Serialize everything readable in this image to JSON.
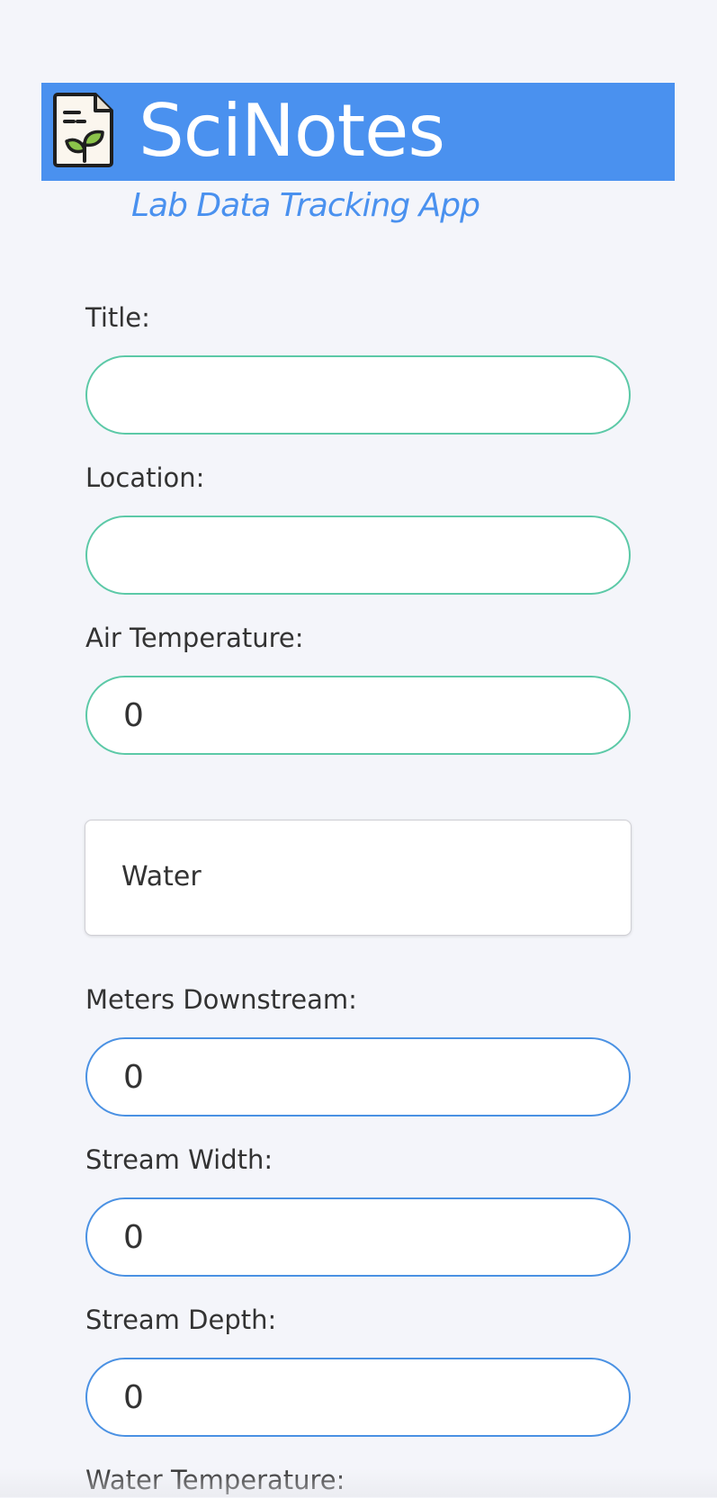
{
  "header": {
    "app_title": "SciNotes",
    "app_subtitle": "Lab Data Tracking App",
    "logo_icon": "document-sprout-icon",
    "banner_color": "#4a91ef"
  },
  "form": {
    "title": {
      "label": "Title:",
      "value": ""
    },
    "location": {
      "label": "Location:",
      "value": ""
    },
    "air_temperature": {
      "label": "Air Temperature:",
      "value": "0"
    },
    "sample_type": {
      "selected": "Water"
    },
    "meters_downstream": {
      "label": "Meters Downstream:",
      "value": "0"
    },
    "stream_width": {
      "label": "Stream Width:",
      "value": "0"
    },
    "stream_depth": {
      "label": "Stream Depth:",
      "value": "0"
    },
    "water_temperature": {
      "label": "Water Temperature:"
    }
  },
  "colors": {
    "accent_blue": "#4a91e3",
    "accent_green": "#5cc9a7",
    "background": "#f4f5fa"
  }
}
